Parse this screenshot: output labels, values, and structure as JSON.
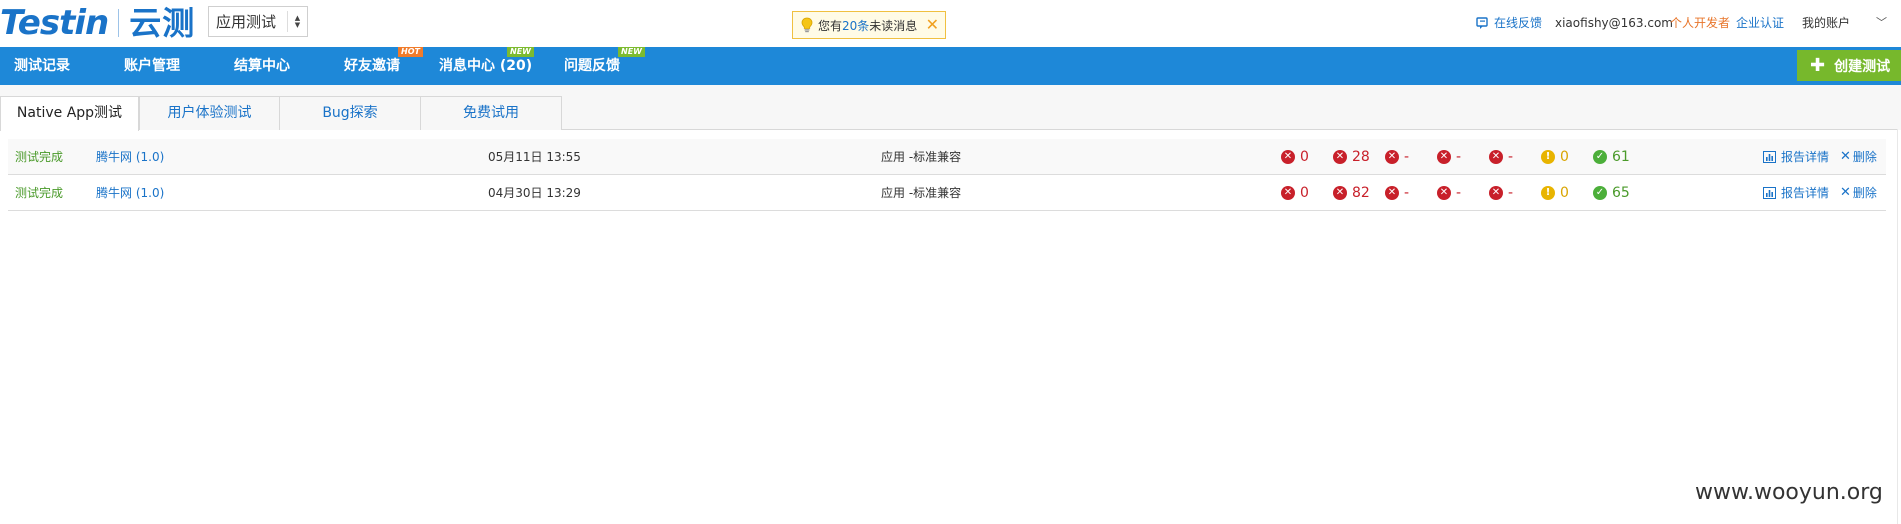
{
  "header": {
    "logo_en": "Testin",
    "logo_cn": "云测",
    "app_select": "应用测试",
    "notice": {
      "prefix": "您有",
      "count": "20条",
      "suffix": "未读消息"
    },
    "feedback": "在线反馈",
    "email": "xiaofishy@163.com",
    "personal_dev": "个人开发者",
    "enterprise_auth": "企业认证",
    "my_account": "我的账户"
  },
  "nav": {
    "items": [
      {
        "label": "测试记录"
      },
      {
        "label": "账户管理"
      },
      {
        "label": "结算中心"
      },
      {
        "label": "好友邀请",
        "badge": "HOT"
      },
      {
        "label": "消息中心 (20)",
        "badge": "NEW"
      },
      {
        "label": "问题反馈",
        "badge": "NEW"
      }
    ],
    "create_button": "创建测试"
  },
  "tabs": [
    {
      "label": "Native App测试",
      "active": true
    },
    {
      "label": "用户体验测试"
    },
    {
      "label": "Bug探索"
    },
    {
      "label": "免费试用"
    }
  ],
  "rows": [
    {
      "status": "测试完成",
      "app": "腾牛网 (1.0)",
      "time": "05月11日 13:55",
      "type": "应用 -标准兼容",
      "metrics": [
        "0",
        "28",
        "-",
        "-",
        "-",
        "0",
        "61"
      ],
      "report": "报告详情",
      "delete": "删除"
    },
    {
      "status": "测试完成",
      "app": "腾牛网 (1.0)",
      "time": "04月30日 13:29",
      "type": "应用 -标准兼容",
      "metrics": [
        "0",
        "82",
        "-",
        "-",
        "-",
        "0",
        "65"
      ],
      "report": "报告详情",
      "delete": "删除"
    }
  ],
  "watermark": "www.wooyun.org"
}
